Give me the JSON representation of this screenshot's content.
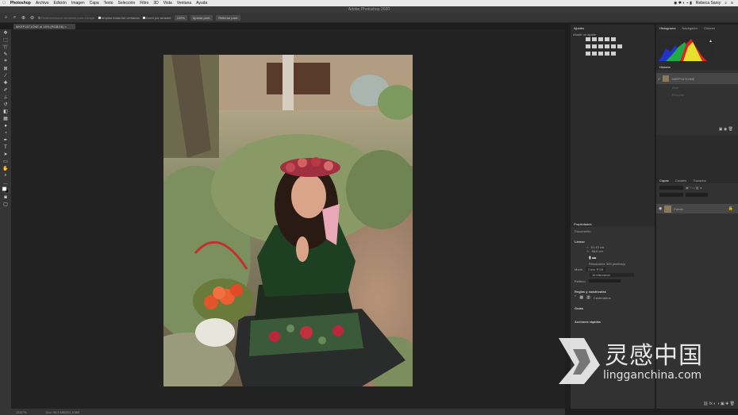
{
  "menubar": {
    "app": "Photoshop",
    "items": [
      "Archivo",
      "Edición",
      "Imagen",
      "Capa",
      "Texto",
      "Selección",
      "Filtro",
      "3D",
      "Vista",
      "Ventana",
      "Ayuda"
    ],
    "user": "Rebeca Sarsy"
  },
  "window": {
    "title": "Adobe Photoshop 2020"
  },
  "options": {
    "resize_windows": "Redimensionar ventanas para encajar",
    "zoom_all": "Ampliar todas las ventanas",
    "scrubby_zoom": "Zoom por arrastre",
    "zoom_100": "100%",
    "fit_screen": "Ajustar pant.",
    "fill_screen": "Rellenar pant."
  },
  "document": {
    "tab": "MKEP1671ONE al 14% (RGB/16) ×",
    "zoom": "13.67%",
    "doc_info": "Doc: 95,9 MB/201,5 MB"
  },
  "panels": {
    "adjustments": {
      "tab": "Ajustes",
      "hint": "Añadir un ajuste"
    },
    "histogram": {
      "tabs": [
        "Histograma",
        "Navegador",
        "Colores"
      ]
    },
    "history": {
      "tab": "Historia",
      "snapshot": "MKEP1671ONE",
      "steps": [
        "Abrir",
        "Recortar"
      ]
    },
    "properties": {
      "tab": "Propiedades",
      "type": "Documento",
      "canvas_header": "Lienzo",
      "width": "51,43 cm",
      "height": "68,6 cm",
      "resolution_label": "Resolución: 300 píxeles/p",
      "mode_label": "Modo",
      "mode_value": "Color RGB",
      "depth_value": "16 bits/canal",
      "bg_label": "Relleno",
      "rulers_header": "Reglas y cuadrículas",
      "rulers_unit": "Centímetros",
      "guides_header": "Guías",
      "quick_actions": "Acciones rápidas"
    },
    "layers": {
      "tabs": [
        "Capas",
        "Canales",
        "Trazados"
      ],
      "layer_name": "Fondo"
    }
  },
  "watermark": {
    "text": "lingganchina.com",
    "cn": "灵感中国"
  },
  "colors": {
    "accent": "#2f7fd6",
    "panel": "#323232",
    "canvas": "#222222"
  }
}
